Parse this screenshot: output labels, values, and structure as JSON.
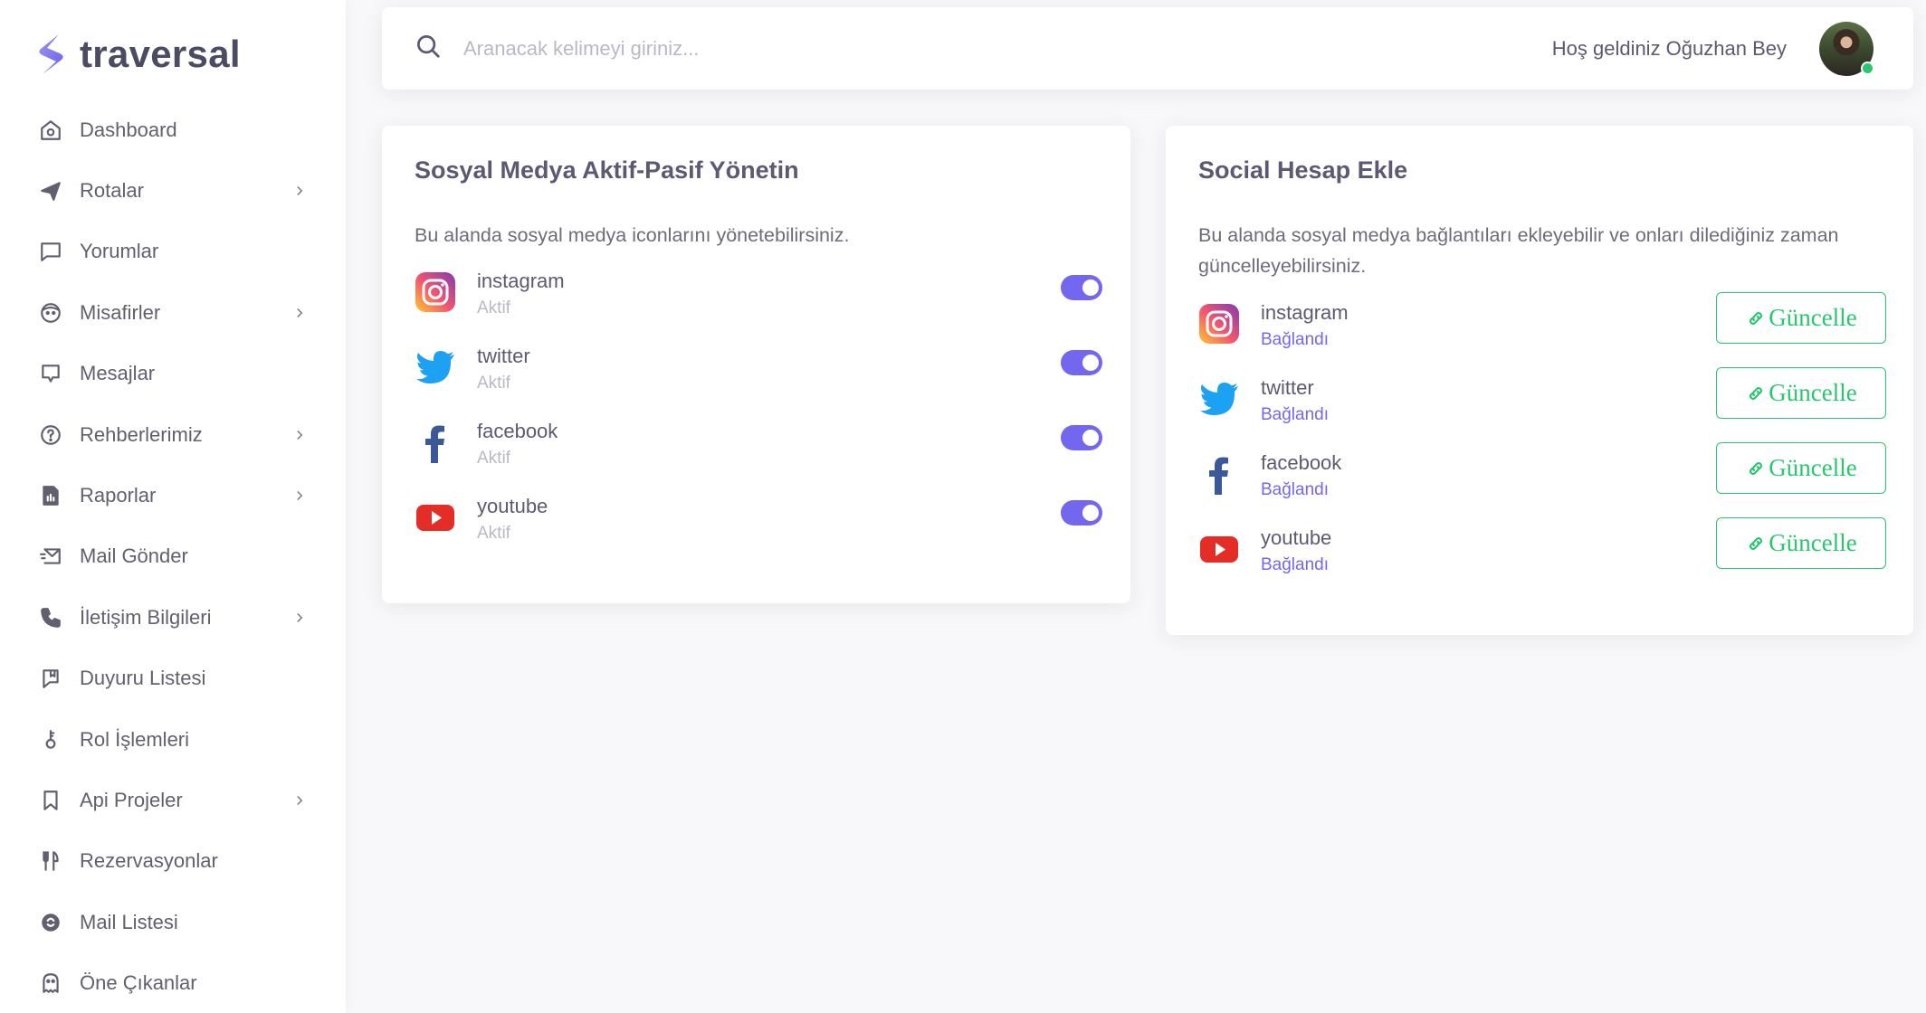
{
  "brand": {
    "name": "traversal",
    "accent": "#7367f0"
  },
  "sidebar": {
    "items": [
      {
        "label": "Dashboard",
        "icon": "home-icon",
        "has_children": false
      },
      {
        "label": "Rotalar",
        "icon": "plane-icon",
        "has_children": true
      },
      {
        "label": "Yorumlar",
        "icon": "comment-icon",
        "has_children": false
      },
      {
        "label": "Misafirler",
        "icon": "face-icon",
        "has_children": true
      },
      {
        "label": "Mesajlar",
        "icon": "message-square-icon",
        "has_children": false
      },
      {
        "label": "Rehberlerimiz",
        "icon": "help-circle-icon",
        "has_children": true
      },
      {
        "label": "Raporlar",
        "icon": "report-icon",
        "has_children": true
      },
      {
        "label": "Mail Gönder",
        "icon": "mail-send-icon",
        "has_children": false
      },
      {
        "label": "İletişim Bilgileri",
        "icon": "phone-icon",
        "has_children": true
      },
      {
        "label": "Duyuru Listesi",
        "icon": "announcement-icon",
        "has_children": false
      },
      {
        "label": "Rol İşlemleri",
        "icon": "role-key-icon",
        "has_children": false
      },
      {
        "label": "Api Projeler",
        "icon": "bookmark-icon",
        "has_children": true
      },
      {
        "label": "Rezervasyonlar",
        "icon": "restaurant-icon",
        "has_children": false
      },
      {
        "label": "Mail Listesi",
        "icon": "mailchimp-icon",
        "has_children": false
      },
      {
        "label": "Öne Çıkanlar",
        "icon": "ghost-icon",
        "has_children": false
      }
    ]
  },
  "header": {
    "search_placeholder": "Aranacak kelimeyi giriniz...",
    "welcome": "Hoş geldiniz Oğuzhan Bey"
  },
  "left_card": {
    "title": "Sosyal Medya Aktif-Pasif Yönetin",
    "description": "Bu alanda sosyal medya iconlarını yönetebilirsiniz.",
    "items": [
      {
        "name": "instagram",
        "status": "Aktif",
        "enabled": true,
        "icon": "instagram-icon"
      },
      {
        "name": "twitter",
        "status": "Aktif",
        "enabled": true,
        "icon": "twitter-icon"
      },
      {
        "name": "facebook",
        "status": "Aktif",
        "enabled": true,
        "icon": "facebook-icon"
      },
      {
        "name": "youtube",
        "status": "Aktif",
        "enabled": true,
        "icon": "youtube-icon"
      }
    ]
  },
  "right_card": {
    "title": "Social Hesap Ekle",
    "description": "Bu alanda sosyal medya bağlantıları ekleyebilir ve onları dilediğiniz zaman güncelleyebilirsiniz.",
    "button_label": "Güncelle",
    "items": [
      {
        "name": "instagram",
        "status": "Bağlandı",
        "icon": "instagram-icon"
      },
      {
        "name": "twitter",
        "status": "Bağlandı",
        "icon": "twitter-icon"
      },
      {
        "name": "facebook",
        "status": "Bağlandı",
        "icon": "facebook-icon"
      },
      {
        "name": "youtube",
        "status": "Bağlandı",
        "icon": "youtube-icon"
      }
    ]
  },
  "colors": {
    "primary": "#7367f0",
    "success": "#28c76f",
    "muted": "#b9b9c3",
    "background": "#f8f8fa"
  }
}
